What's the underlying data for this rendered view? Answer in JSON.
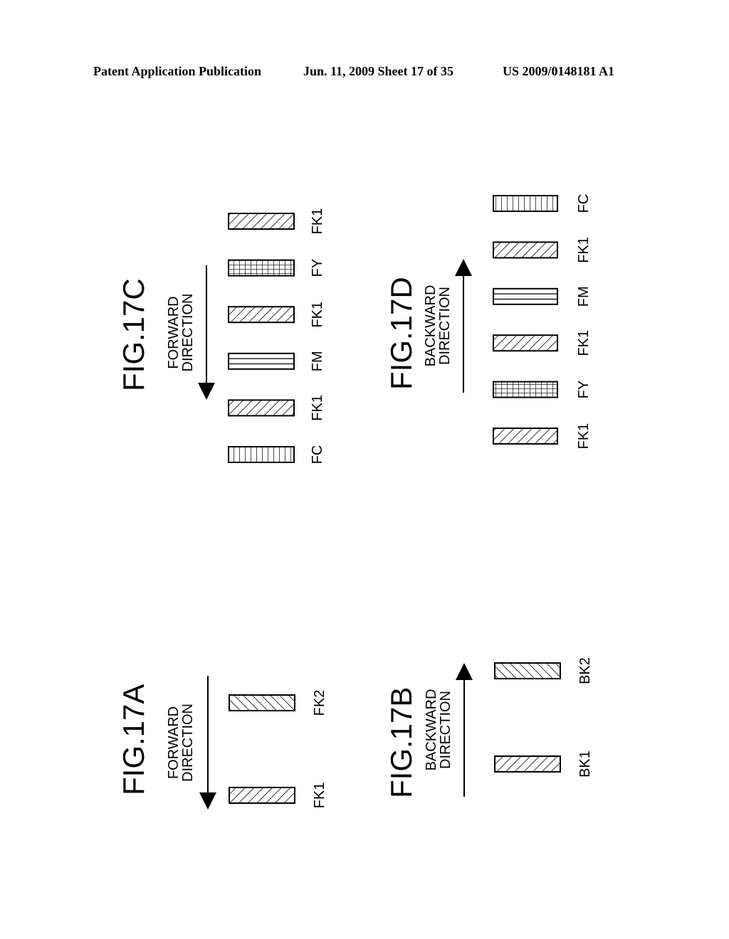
{
  "header": {
    "publication": "Patent Application Publication",
    "date_sheet": "Jun. 11, 2009  Sheet 17 of 35",
    "number": "US 2009/0148181 A1"
  },
  "figures": [
    {
      "id": "fig17a",
      "title": "FIG.17A",
      "direction": "forward",
      "direction_label": [
        "FORWARD",
        "DIRECTION"
      ],
      "bars": [
        {
          "label": "FK1",
          "pattern": "hatch-back"
        },
        {
          "label": "FK2",
          "pattern": "hatch-fwd"
        }
      ]
    },
    {
      "id": "fig17b",
      "title": "FIG.17B",
      "direction": "backward",
      "direction_label": [
        "BACKWARD",
        "DIRECTION"
      ],
      "bars": [
        {
          "label": "BK1",
          "pattern": "hatch-back"
        },
        {
          "label": "BK2",
          "pattern": "hatch-fwd"
        }
      ]
    },
    {
      "id": "fig17c",
      "title": "FIG.17C",
      "direction": "forward",
      "direction_label": [
        "FORWARD",
        "DIRECTION"
      ],
      "bars": [
        {
          "label": "FC",
          "pattern": "vertical"
        },
        {
          "label": "FK1",
          "pattern": "hatch-back"
        },
        {
          "label": "FM",
          "pattern": "horizontal"
        },
        {
          "label": "FK1",
          "pattern": "hatch-back"
        },
        {
          "label": "FY",
          "pattern": "grid"
        },
        {
          "label": "FK1",
          "pattern": "hatch-back"
        }
      ]
    },
    {
      "id": "fig17d",
      "title": "FIG.17D",
      "direction": "backward",
      "direction_label": [
        "BACKWARD",
        "DIRECTION"
      ],
      "bars": [
        {
          "label": "FK1",
          "pattern": "hatch-back"
        },
        {
          "label": "FY",
          "pattern": "grid"
        },
        {
          "label": "FK1",
          "pattern": "hatch-back"
        },
        {
          "label": "FM",
          "pattern": "horizontal"
        },
        {
          "label": "FK1",
          "pattern": "hatch-back"
        },
        {
          "label": "FC",
          "pattern": "vertical"
        }
      ]
    }
  ]
}
